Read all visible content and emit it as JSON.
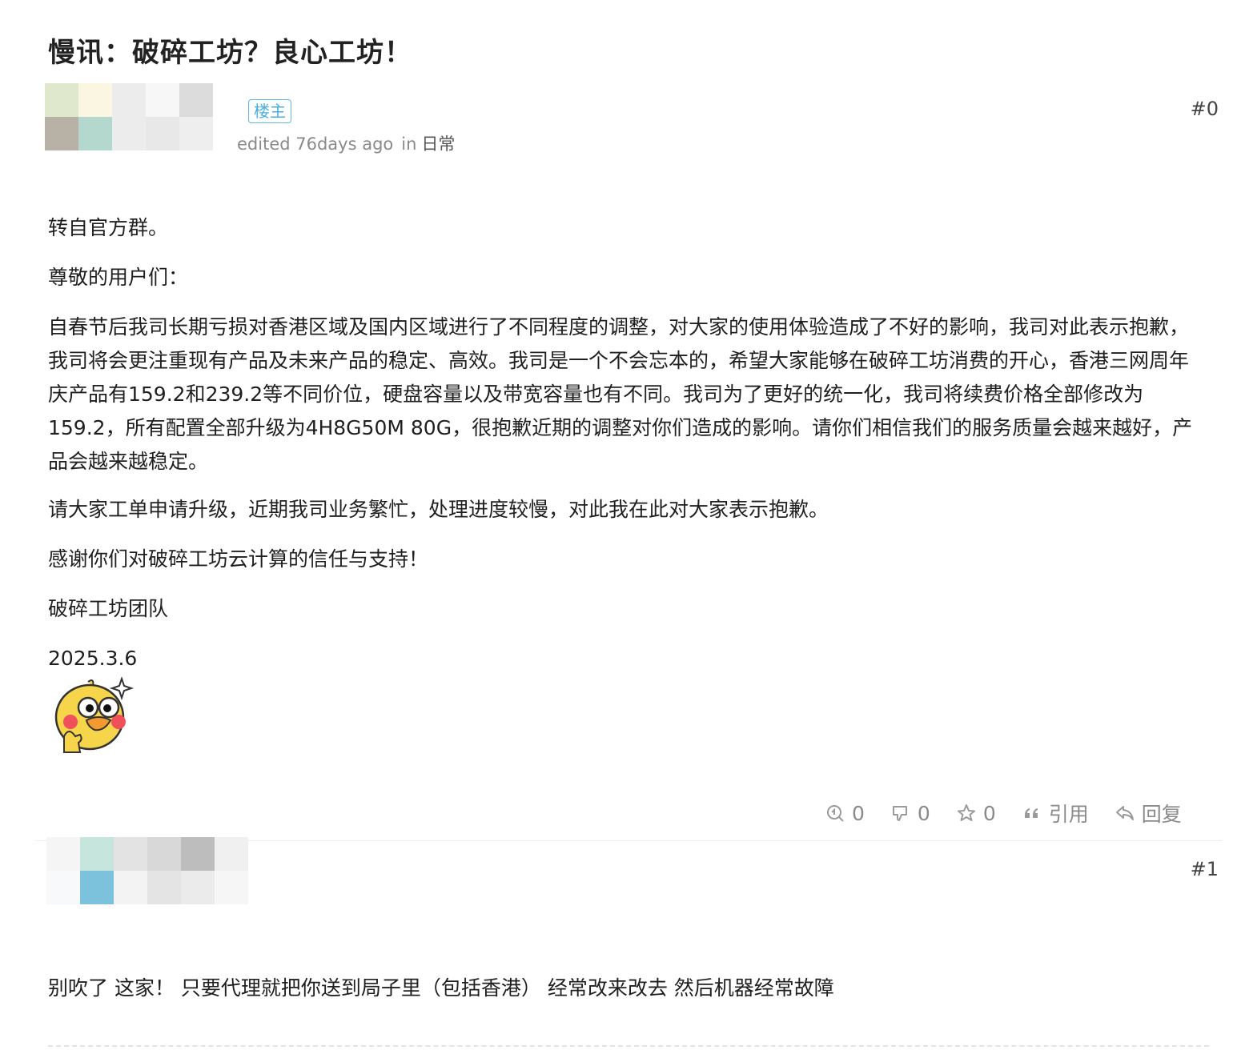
{
  "topic": {
    "title": "慢讯：破碎工坊？良心工坊！"
  },
  "posts": [
    {
      "floor": "#0",
      "op_badge": "楼主",
      "meta": {
        "edited": "edited 76days ago",
        "in_label": "in",
        "category": "日常"
      },
      "content": [
        "转自官方群。",
        "尊敬的用户们：",
        "自春节后我司长期亏损对香港区域及国内区域进行了不同程度的调整，对大家的使用体验造成了不好的影响，我司对此表示抱歉，我司将会更注重现有产品及未来产品的稳定、高效。我司是一个不会忘本的，希望大家能够在破碎工坊消费的开心，香港三网周年庆产品有159.2和239.2等不同价位，硬盘容量以及带宽容量也有不同。我司为了更好的统一化，我司将续费价格全部修改为159.2，所有配置全部升级为4H8G50M 80G，很抱歉近期的调整对你们造成的影响。请你们相信我们的服务质量会越来越好，产品会越来越稳定。",
        "请大家工单申请升级，近期我司业务繁忙，处理进度较慢，对此我在此对大家表示抱歉。",
        "感谢你们对破碎工坊云计算的信任与支持！",
        "破碎工坊团队",
        "2025.3.6"
      ],
      "actions": {
        "like": "0",
        "dislike": "0",
        "favorite": "0",
        "quote": "引用",
        "reply": "回复"
      }
    },
    {
      "floor": "#1",
      "content": [
        "别吹了 这家！ 只要代理就把你送到局子里（包括香港） 经常改来改去 然后机器经常故障"
      ]
    }
  ],
  "colors": {
    "accent": "#4aaee0",
    "muted_text": "#8a8a8a",
    "avatar0": [
      "#dfe8cc",
      "#fbf6e2",
      "#ececec",
      "#f7f7f7",
      "#dcdcdc",
      "#b8b1a6",
      "#b4d8cd",
      "#ececec",
      "#e8e8e8",
      "#eeeeee"
    ],
    "avatar1": [
      "#f5f5f5",
      "#c6e5dc",
      "#e3e3e3",
      "#d8d8d8",
      "#bdbdbd",
      "#f0f0f0",
      "#f7f9fa",
      "#7dc2dc",
      "#f3f3f3",
      "#e4e4e4",
      "#ebebeb",
      "#f6f6f6"
    ]
  },
  "icons": {
    "like": "thumb-up-icon",
    "dislike": "thumb-down-icon",
    "favorite": "star-icon",
    "quote": "quote-icon",
    "reply": "reply-icon",
    "sticker": "yellow-duck-sticker"
  }
}
